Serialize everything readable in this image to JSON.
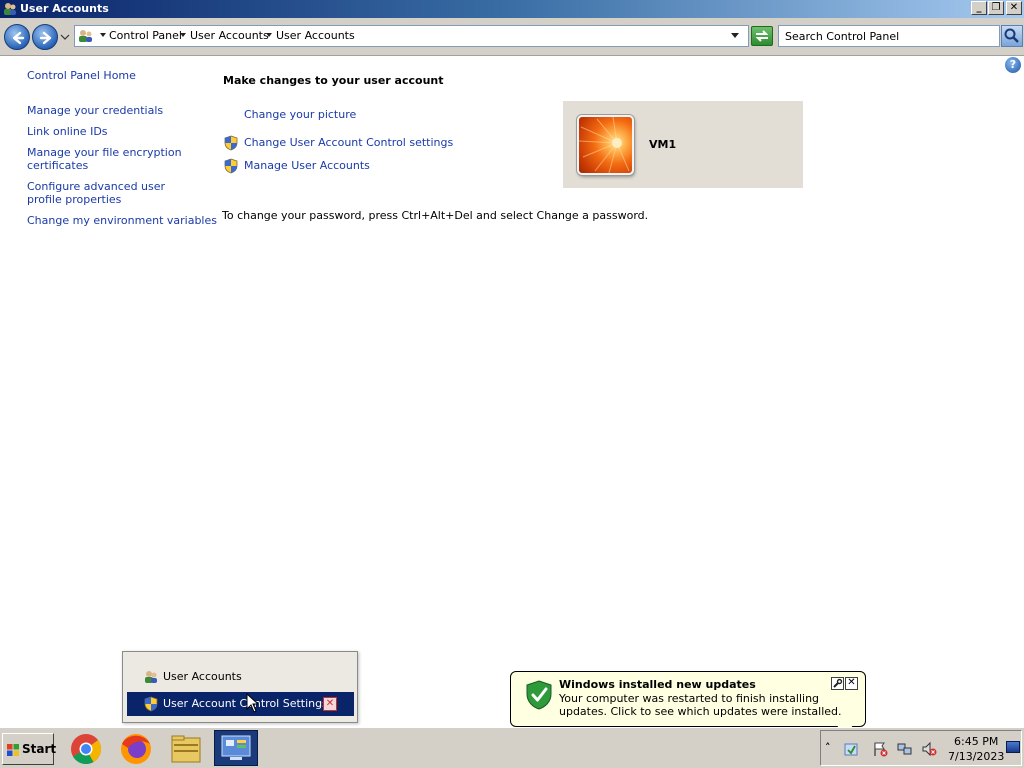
{
  "window": {
    "title": "User Accounts",
    "buttons": {
      "minimize": "_",
      "restore": "❐",
      "close": "✕"
    }
  },
  "address_bar": {
    "crumbs": [
      "Control Panel",
      "User Accounts",
      "User Accounts"
    ],
    "search_placeholder": "Search Control Panel"
  },
  "help": {
    "label": "?"
  },
  "left_nav": {
    "home": "Control Panel Home",
    "links": [
      "Manage your credentials",
      "Link online IDs",
      "Manage your file encryption certificates",
      "Configure advanced user profile properties",
      "Change my environment variables"
    ]
  },
  "main": {
    "heading": "Make changes to your user account",
    "tasks": [
      {
        "label": "Change your picture",
        "icon": "none"
      },
      {
        "label": "Change User Account Control settings",
        "icon": "uac-shield-icon"
      },
      {
        "label": "Manage User Accounts",
        "icon": "uac-shield-icon"
      }
    ],
    "password_hint": "To change your password, press Ctrl+Alt+Del and select Change a password.",
    "account": {
      "name": "VM1"
    }
  },
  "taskbar_popup": {
    "items": [
      "User Accounts",
      "User Account Control Settings"
    ],
    "close_label": "✕"
  },
  "balloon": {
    "title": "Windows installed new updates",
    "text": "Your computer was restarted to finish installing updates. Click to see which updates were installed.",
    "close_label": "✕"
  },
  "taskbar": {
    "start_label": "Start",
    "apps": [
      "chrome-icon",
      "firefox-icon",
      "file-explorer-icon",
      "control-panel-icon"
    ],
    "tray_chevron": "˄",
    "clock_time": "6:45 PM",
    "clock_date": "7/13/2023"
  },
  "colors": {
    "link": "#1a3aa8",
    "title_gradient_start": "#0a246a",
    "selection": "#0a246a",
    "balloon_bg": "#ffffe1"
  }
}
